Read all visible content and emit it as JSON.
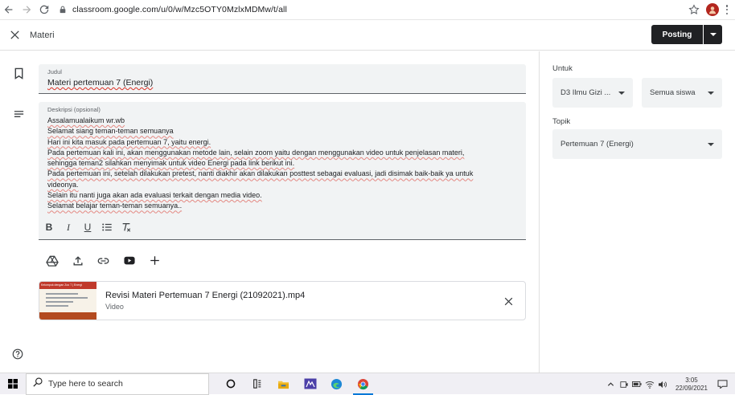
{
  "browser": {
    "url": "classroom.google.com/u/0/w/Mzc5OTY0MzlxMDMw/t/all"
  },
  "header": {
    "title": "Materi",
    "post_label": "Posting"
  },
  "form": {
    "title_label": "Judul",
    "title_value": "Materi pertemuan 7 (Energi)",
    "desc_label": "Deskripsi (opsional)",
    "desc_lines": [
      "Assalamualaikum wr.wb",
      "Selamat siang teman-teman semuanya",
      "Hari ini kita masuk pada pertemuan 7, yaitu energi.",
      "Pada pertemuan kali ini, akan menggunakan metode lain, selain zoom yaitu dengan menggunakan video untuk penjelasan materi,",
      "sehingga teman2 silahkan menyimak untuk video Energi pada link berikut ini.",
      "Pada pertemuan ini, setelah dilakukan pretest, nanti diakhir akan dilakukan posttest sebagai evaluasi, jadi disimak baik-baik ya untuk",
      "videonya.",
      "Selain itu nanti juga akan ada evaluasi terkait dengan media video.",
      "Selamat belajar teman-teman semuanya.."
    ]
  },
  "format_toolbar": {
    "bold": "B",
    "italic": "I",
    "underline": "U"
  },
  "attachment": {
    "title": "Revisi Materi Pertemuan 7 Energi (21092021).mp4",
    "type": "Video",
    "thumb_header": "Kelompok dengan Zoo 7 | Energi"
  },
  "panel": {
    "for_label": "Untuk",
    "class_value": "D3 Ilmu Gizi ...",
    "students_value": "Semua siswa",
    "topic_label": "Topik",
    "topic_value": "Pertemuan 7 (Energi)"
  },
  "taskbar": {
    "search_placeholder": "Type here to search",
    "time": "3:05",
    "date": "22/09/2021"
  },
  "colors": {
    "accent_dark": "#202124",
    "field_bg": "#f1f3f4",
    "spell_underline": "#d93025"
  }
}
